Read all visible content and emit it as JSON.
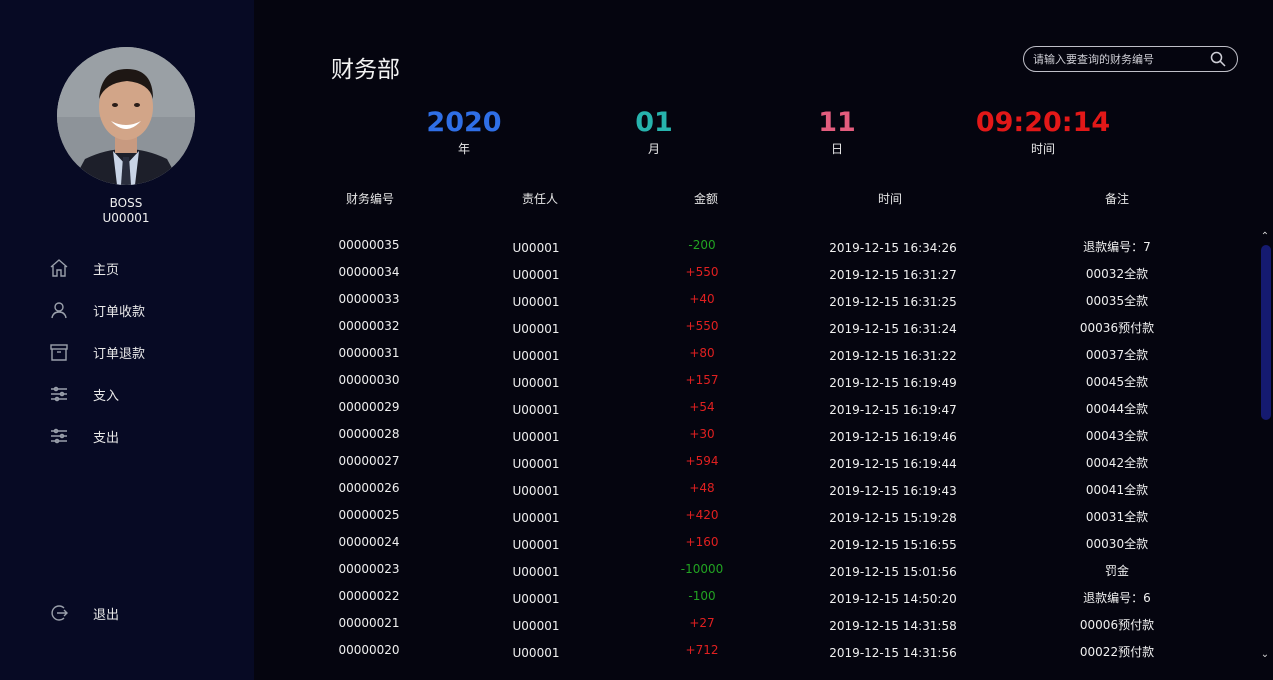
{
  "user": {
    "name": "BOSS",
    "id": "U00001"
  },
  "nav": [
    {
      "label": "主页",
      "icon": "home-icon"
    },
    {
      "label": "订单收款",
      "icon": "user-icon"
    },
    {
      "label": "订单退款",
      "icon": "archive-icon"
    },
    {
      "label": "支入",
      "icon": "sliders-icon"
    },
    {
      "label": "支出",
      "icon": "sliders-icon"
    }
  ],
  "logout": {
    "label": "退出",
    "icon": "logout-icon"
  },
  "page_title": "财务部",
  "search": {
    "placeholder": "请输入要查询的财务编号",
    "icon": "search-icon"
  },
  "date": {
    "year": {
      "value": "2020",
      "unit": "年",
      "color": "#2f6fe6"
    },
    "month": {
      "value": "01",
      "unit": "月",
      "color": "#27b3ad"
    },
    "day": {
      "value": "11",
      "unit": "日",
      "color": "#e35d7e"
    },
    "time": {
      "value": "09:20:14",
      "unit": "时间",
      "color": "#e31818"
    }
  },
  "table": {
    "columns": [
      "财务编号",
      "责任人",
      "金额",
      "时间",
      "备注"
    ],
    "rows": [
      {
        "id": "00000035",
        "person": "U00001",
        "amount": "-200",
        "time": "2019-12-15 16:34:26",
        "note": "退款编号：7"
      },
      {
        "id": "00000034",
        "person": "U00001",
        "amount": "+550",
        "time": "2019-12-15 16:31:27",
        "note": "00032全款"
      },
      {
        "id": "00000033",
        "person": "U00001",
        "amount": "+40",
        "time": "2019-12-15 16:31:25",
        "note": "00035全款"
      },
      {
        "id": "00000032",
        "person": "U00001",
        "amount": "+550",
        "time": "2019-12-15 16:31:24",
        "note": "00036预付款"
      },
      {
        "id": "00000031",
        "person": "U00001",
        "amount": "+80",
        "time": "2019-12-15 16:31:22",
        "note": "00037全款"
      },
      {
        "id": "00000030",
        "person": "U00001",
        "amount": "+157",
        "time": "2019-12-15 16:19:49",
        "note": "00045全款"
      },
      {
        "id": "00000029",
        "person": "U00001",
        "amount": "+54",
        "time": "2019-12-15 16:19:47",
        "note": "00044全款"
      },
      {
        "id": "00000028",
        "person": "U00001",
        "amount": "+30",
        "time": "2019-12-15 16:19:46",
        "note": "00043全款"
      },
      {
        "id": "00000027",
        "person": "U00001",
        "amount": "+594",
        "time": "2019-12-15 16:19:44",
        "note": "00042全款"
      },
      {
        "id": "00000026",
        "person": "U00001",
        "amount": "+48",
        "time": "2019-12-15 16:19:43",
        "note": "00041全款"
      },
      {
        "id": "00000025",
        "person": "U00001",
        "amount": "+420",
        "time": "2019-12-15 15:19:28",
        "note": "00031全款"
      },
      {
        "id": "00000024",
        "person": "U00001",
        "amount": "+160",
        "time": "2019-12-15 15:16:55",
        "note": "00030全款"
      },
      {
        "id": "00000023",
        "person": "U00001",
        "amount": "-10000",
        "time": "2019-12-15 15:01:56",
        "note": "罚金"
      },
      {
        "id": "00000022",
        "person": "U00001",
        "amount": "-100",
        "time": "2019-12-15 14:50:20",
        "note": "退款编号：6"
      },
      {
        "id": "00000021",
        "person": "U00001",
        "amount": "+27",
        "time": "2019-12-15 14:31:58",
        "note": "00006预付款"
      },
      {
        "id": "00000020",
        "person": "U00001",
        "amount": "+712",
        "time": "2019-12-15 14:31:56",
        "note": "00022预付款"
      }
    ]
  },
  "colors": {
    "sidebar_bg": "#070a24",
    "page_bg": "#05050f",
    "positive_amount": "#e02020",
    "negative_amount": "#22a322",
    "scrollbar_thumb": "#151a70"
  }
}
